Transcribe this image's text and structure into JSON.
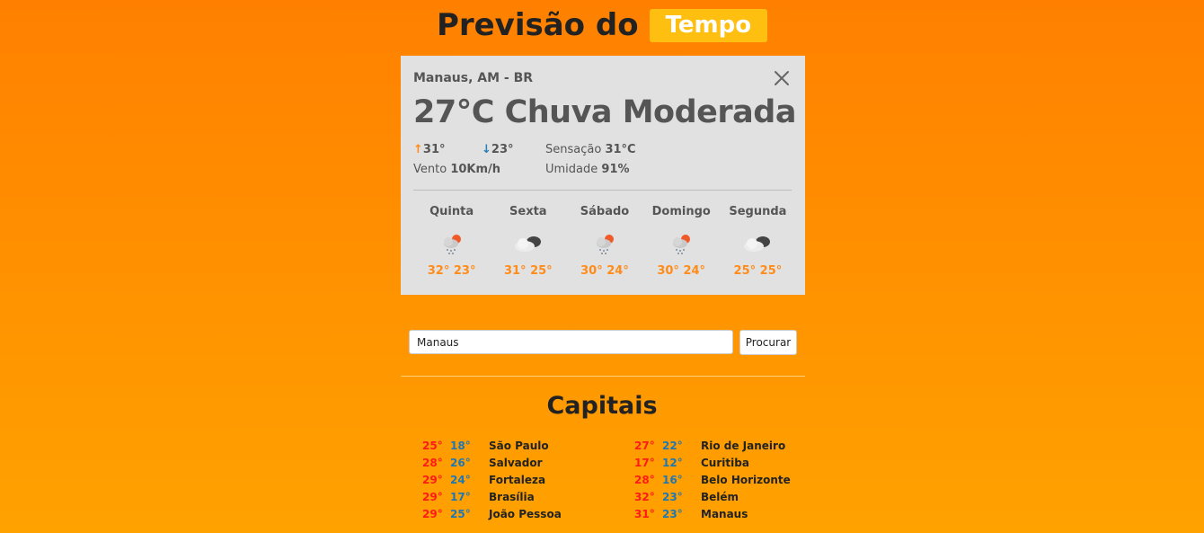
{
  "header": {
    "title": "Previsão do",
    "tag": "Tempo"
  },
  "current": {
    "location": "Manaus, AM - BR",
    "headline": "27°C Chuva Moderada",
    "max": "31°",
    "min": "23°",
    "wind_label": "Vento",
    "wind_value": "10Km/h",
    "feels_label": "Sensação",
    "feels_value": "31°C",
    "humidity_label": "Umidade",
    "humidity_value": "91%"
  },
  "forecast": [
    {
      "day": "Quinta",
      "icon": "rain-sun-icon",
      "max": "32°",
      "min": "23°"
    },
    {
      "day": "Sexta",
      "icon": "cloudy-icon",
      "max": "31°",
      "min": "25°"
    },
    {
      "day": "Sábado",
      "icon": "rain-sun-icon",
      "max": "30°",
      "min": "24°"
    },
    {
      "day": "Domingo",
      "icon": "rain-sun-icon",
      "max": "30°",
      "min": "24°"
    },
    {
      "day": "Segunda",
      "icon": "cloudy-icon",
      "max": "25°",
      "min": "25°"
    }
  ],
  "search": {
    "value": "Manaus",
    "button": "Procurar"
  },
  "capitais": {
    "title": "Capitais",
    "left": [
      {
        "max": "25°",
        "min": "18°",
        "name": "São Paulo"
      },
      {
        "max": "28°",
        "min": "26°",
        "name": "Salvador"
      },
      {
        "max": "29°",
        "min": "24°",
        "name": "Fortaleza"
      },
      {
        "max": "29°",
        "min": "17°",
        "name": "Brasília"
      },
      {
        "max": "29°",
        "min": "25°",
        "name": "João Pessoa"
      }
    ],
    "right": [
      {
        "max": "27°",
        "min": "22°",
        "name": "Rio de Janeiro"
      },
      {
        "max": "17°",
        "min": "12°",
        "name": "Curitiba"
      },
      {
        "max": "28°",
        "min": "16°",
        "name": "Belo Horizonte"
      },
      {
        "max": "32°",
        "min": "23°",
        "name": "Belém"
      },
      {
        "max": "31°",
        "min": "23°",
        "name": "Manaus"
      }
    ]
  },
  "colors": {
    "max": "#ff1a1a",
    "min": "#1f77b4",
    "accent": "#ffbf10",
    "forecast": "#ff8c1a"
  }
}
